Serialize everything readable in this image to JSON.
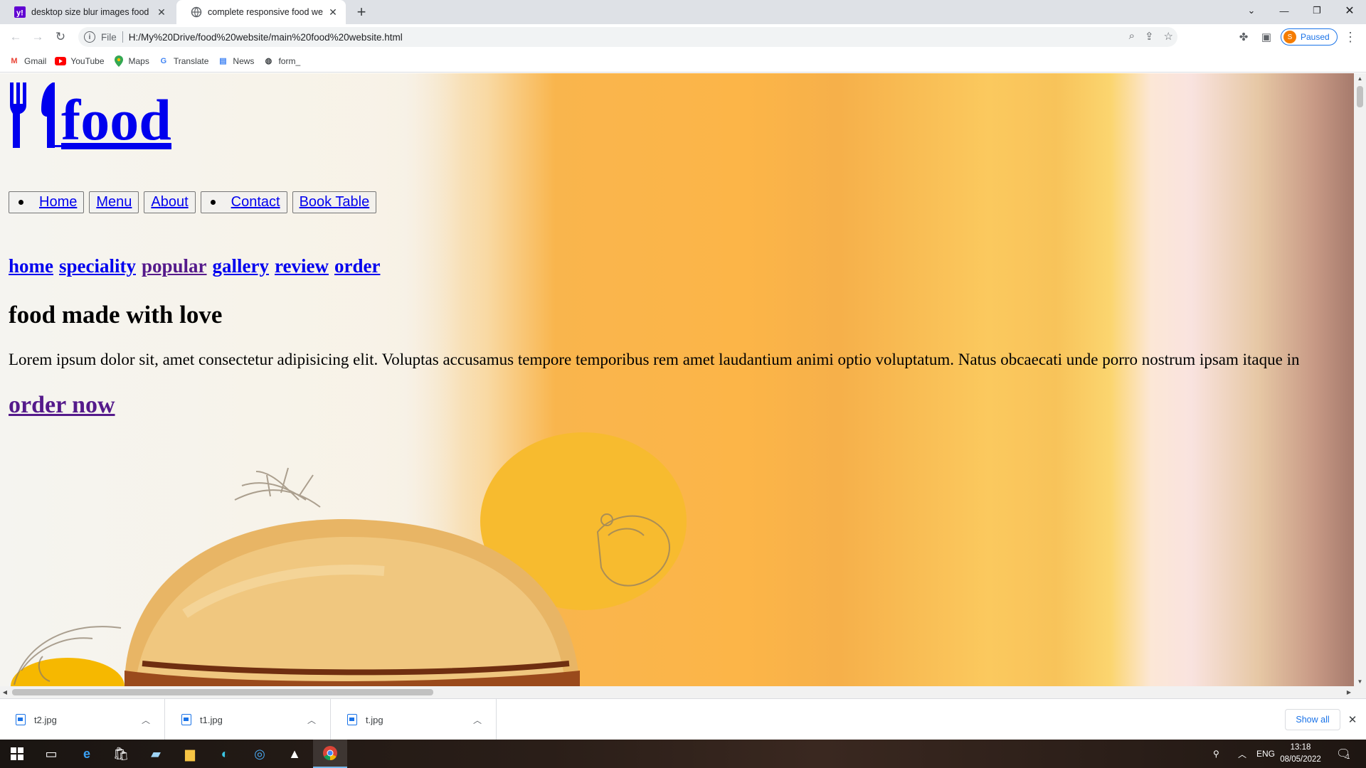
{
  "browser": {
    "tabs": [
      {
        "title": "desktop size blur images food re",
        "active": false,
        "icon": "yahoo-icon"
      },
      {
        "title": "complete responsive food websit",
        "active": true,
        "icon": "globe-icon"
      }
    ],
    "address": {
      "scheme_label": "File",
      "url": "H:/My%20Drive/food%20website/main%20food%20website.html"
    },
    "profile": {
      "initial": "S",
      "label": "Paused"
    },
    "bookmarks": [
      {
        "label": "Gmail",
        "icon": "gmail-icon"
      },
      {
        "label": "YouTube",
        "icon": "youtube-icon"
      },
      {
        "label": "Maps",
        "icon": "maps-icon"
      },
      {
        "label": "Translate",
        "icon": "translate-icon"
      },
      {
        "label": "News",
        "icon": "news-icon"
      },
      {
        "label": "form_",
        "icon": "globe-icon"
      }
    ]
  },
  "page": {
    "logo_text": "food",
    "nav_buttons": [
      {
        "label": "Home",
        "bullet": true
      },
      {
        "label": "Menu",
        "bullet": false
      },
      {
        "label": "About",
        "bullet": false
      },
      {
        "label": "Contact",
        "bullet": true
      },
      {
        "label": "Book Table",
        "bullet": false
      }
    ],
    "section_links": [
      {
        "label": "home",
        "visited": false
      },
      {
        "label": "speciality",
        "visited": false
      },
      {
        "label": "popular",
        "visited": true
      },
      {
        "label": "gallery",
        "visited": false
      },
      {
        "label": "review",
        "visited": false
      },
      {
        "label": "order",
        "visited": false
      }
    ],
    "headline": "food made with love",
    "body_text": "Lorem ipsum dolor sit, amet consectetur adipisicing elit. Voluptas accusamus tempore temporibus rem amet laudantium animi optio voluptatum. Natus obcaecati unde porro nostrum ipsam itaque in",
    "cta": "order now"
  },
  "downloads": {
    "items": [
      {
        "name": "t2.jpg"
      },
      {
        "name": "t1.jpg"
      },
      {
        "name": "t.jpg"
      }
    ],
    "show_all": "Show all"
  },
  "taskbar": {
    "apps": [
      "windows-start-icon",
      "task-view-icon",
      "edge-legacy-icon",
      "store-icon",
      "notepad-icon",
      "file-explorer-icon",
      "edge-icon",
      "safari-like-icon",
      "photos-icon",
      "chrome-icon"
    ],
    "language": "ENG",
    "time": "13:18",
    "date": "08/05/2022",
    "notification_count": "1"
  },
  "colors": {
    "link": "#0000ee",
    "visited_link": "#551a8b",
    "accent": "#1a73e8"
  }
}
